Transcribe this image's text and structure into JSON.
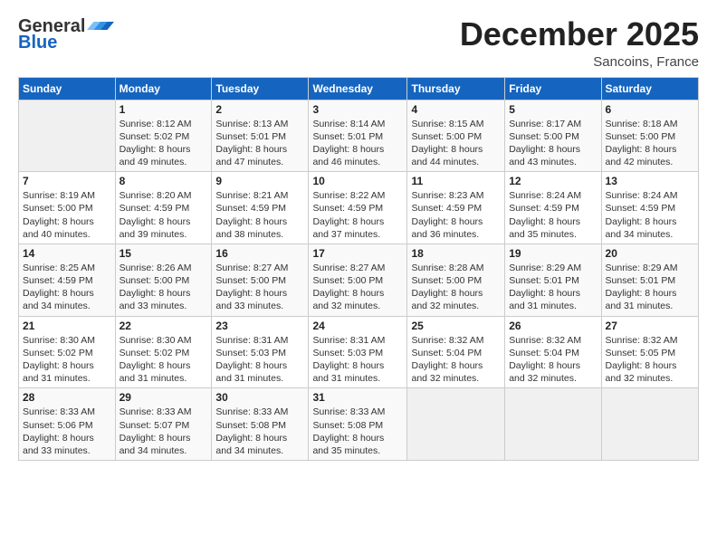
{
  "header": {
    "logo_line1": "General",
    "logo_line2": "Blue",
    "month_title": "December 2025",
    "location": "Sancoins, France"
  },
  "weekdays": [
    "Sunday",
    "Monday",
    "Tuesday",
    "Wednesday",
    "Thursday",
    "Friday",
    "Saturday"
  ],
  "weeks": [
    [
      {
        "day": "",
        "info": ""
      },
      {
        "day": "1",
        "info": "Sunrise: 8:12 AM\nSunset: 5:02 PM\nDaylight: 8 hours\nand 49 minutes."
      },
      {
        "day": "2",
        "info": "Sunrise: 8:13 AM\nSunset: 5:01 PM\nDaylight: 8 hours\nand 47 minutes."
      },
      {
        "day": "3",
        "info": "Sunrise: 8:14 AM\nSunset: 5:01 PM\nDaylight: 8 hours\nand 46 minutes."
      },
      {
        "day": "4",
        "info": "Sunrise: 8:15 AM\nSunset: 5:00 PM\nDaylight: 8 hours\nand 44 minutes."
      },
      {
        "day": "5",
        "info": "Sunrise: 8:17 AM\nSunset: 5:00 PM\nDaylight: 8 hours\nand 43 minutes."
      },
      {
        "day": "6",
        "info": "Sunrise: 8:18 AM\nSunset: 5:00 PM\nDaylight: 8 hours\nand 42 minutes."
      }
    ],
    [
      {
        "day": "7",
        "info": "Sunrise: 8:19 AM\nSunset: 5:00 PM\nDaylight: 8 hours\nand 40 minutes."
      },
      {
        "day": "8",
        "info": "Sunrise: 8:20 AM\nSunset: 4:59 PM\nDaylight: 8 hours\nand 39 minutes."
      },
      {
        "day": "9",
        "info": "Sunrise: 8:21 AM\nSunset: 4:59 PM\nDaylight: 8 hours\nand 38 minutes."
      },
      {
        "day": "10",
        "info": "Sunrise: 8:22 AM\nSunset: 4:59 PM\nDaylight: 8 hours\nand 37 minutes."
      },
      {
        "day": "11",
        "info": "Sunrise: 8:23 AM\nSunset: 4:59 PM\nDaylight: 8 hours\nand 36 minutes."
      },
      {
        "day": "12",
        "info": "Sunrise: 8:24 AM\nSunset: 4:59 PM\nDaylight: 8 hours\nand 35 minutes."
      },
      {
        "day": "13",
        "info": "Sunrise: 8:24 AM\nSunset: 4:59 PM\nDaylight: 8 hours\nand 34 minutes."
      }
    ],
    [
      {
        "day": "14",
        "info": "Sunrise: 8:25 AM\nSunset: 4:59 PM\nDaylight: 8 hours\nand 34 minutes."
      },
      {
        "day": "15",
        "info": "Sunrise: 8:26 AM\nSunset: 5:00 PM\nDaylight: 8 hours\nand 33 minutes."
      },
      {
        "day": "16",
        "info": "Sunrise: 8:27 AM\nSunset: 5:00 PM\nDaylight: 8 hours\nand 33 minutes."
      },
      {
        "day": "17",
        "info": "Sunrise: 8:27 AM\nSunset: 5:00 PM\nDaylight: 8 hours\nand 32 minutes."
      },
      {
        "day": "18",
        "info": "Sunrise: 8:28 AM\nSunset: 5:00 PM\nDaylight: 8 hours\nand 32 minutes."
      },
      {
        "day": "19",
        "info": "Sunrise: 8:29 AM\nSunset: 5:01 PM\nDaylight: 8 hours\nand 31 minutes."
      },
      {
        "day": "20",
        "info": "Sunrise: 8:29 AM\nSunset: 5:01 PM\nDaylight: 8 hours\nand 31 minutes."
      }
    ],
    [
      {
        "day": "21",
        "info": "Sunrise: 8:30 AM\nSunset: 5:02 PM\nDaylight: 8 hours\nand 31 minutes."
      },
      {
        "day": "22",
        "info": "Sunrise: 8:30 AM\nSunset: 5:02 PM\nDaylight: 8 hours\nand 31 minutes."
      },
      {
        "day": "23",
        "info": "Sunrise: 8:31 AM\nSunset: 5:03 PM\nDaylight: 8 hours\nand 31 minutes."
      },
      {
        "day": "24",
        "info": "Sunrise: 8:31 AM\nSunset: 5:03 PM\nDaylight: 8 hours\nand 31 minutes."
      },
      {
        "day": "25",
        "info": "Sunrise: 8:32 AM\nSunset: 5:04 PM\nDaylight: 8 hours\nand 32 minutes."
      },
      {
        "day": "26",
        "info": "Sunrise: 8:32 AM\nSunset: 5:04 PM\nDaylight: 8 hours\nand 32 minutes."
      },
      {
        "day": "27",
        "info": "Sunrise: 8:32 AM\nSunset: 5:05 PM\nDaylight: 8 hours\nand 32 minutes."
      }
    ],
    [
      {
        "day": "28",
        "info": "Sunrise: 8:33 AM\nSunset: 5:06 PM\nDaylight: 8 hours\nand 33 minutes."
      },
      {
        "day": "29",
        "info": "Sunrise: 8:33 AM\nSunset: 5:07 PM\nDaylight: 8 hours\nand 34 minutes."
      },
      {
        "day": "30",
        "info": "Sunrise: 8:33 AM\nSunset: 5:08 PM\nDaylight: 8 hours\nand 34 minutes."
      },
      {
        "day": "31",
        "info": "Sunrise: 8:33 AM\nSunset: 5:08 PM\nDaylight: 8 hours\nand 35 minutes."
      },
      {
        "day": "",
        "info": ""
      },
      {
        "day": "",
        "info": ""
      },
      {
        "day": "",
        "info": ""
      }
    ]
  ]
}
